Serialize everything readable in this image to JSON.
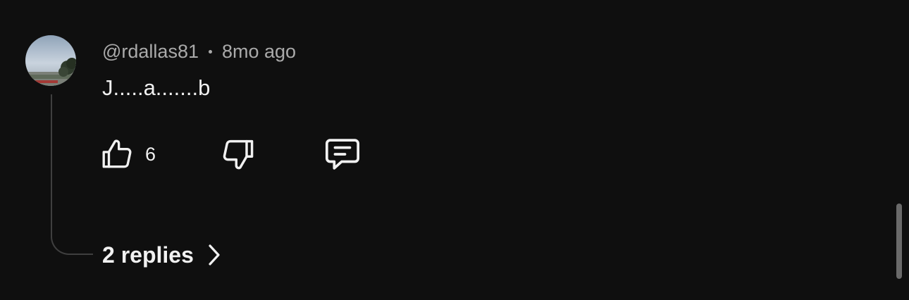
{
  "comment": {
    "author": "@rdallas81",
    "time_ago": "8mo ago",
    "text": "J.....a.......b",
    "like_count": "6",
    "replies_label": "2 replies"
  },
  "icons": {
    "like": "thumbs-up-icon",
    "dislike": "thumbs-down-icon",
    "reply": "comment-icon",
    "expand": "chevron-right-icon"
  },
  "colors": {
    "background": "#0f0f0f",
    "primary_text": "#f1f1f1",
    "secondary_text": "#aaaaaa",
    "thread_line": "#3f3f3f"
  }
}
